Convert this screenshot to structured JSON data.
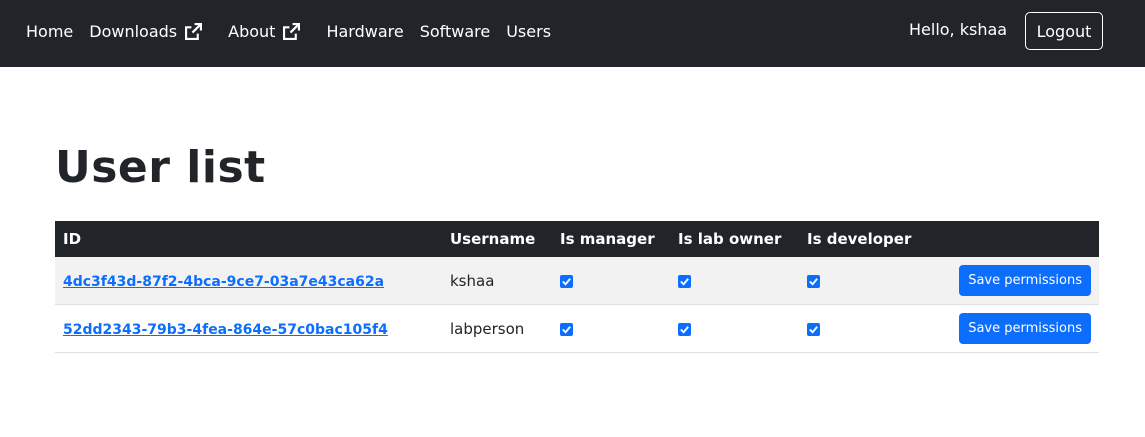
{
  "navbar": {
    "links": [
      {
        "label": "Home"
      },
      {
        "label": "Downloads",
        "icon": "external-link-icon"
      },
      {
        "label": "About",
        "icon": "external-link-icon"
      },
      {
        "label": "Hardware"
      },
      {
        "label": "Software"
      },
      {
        "label": "Users"
      }
    ],
    "greeting": "Hello, kshaa",
    "logout_label": "Logout"
  },
  "main": {
    "title": "User list",
    "table": {
      "headers": [
        "ID",
        "Username",
        "Is manager",
        "Is lab owner",
        "Is developer",
        ""
      ],
      "rows": [
        {
          "id": "4dc3f43d-87f2-4bca-9ce7-03a7e43ca62a",
          "username": "kshaa",
          "is_manager": true,
          "is_lab_owner": true,
          "is_developer": true,
          "action_label": "Save permissions"
        },
        {
          "id": "52dd2343-79b3-4fea-864e-57c0bac105f4",
          "username": "labperson",
          "is_manager": true,
          "is_lab_owner": true,
          "is_developer": true,
          "action_label": "Save permissions"
        }
      ]
    }
  },
  "colors": {
    "navbar_bg": "#212529",
    "accent": "#0d6efd",
    "row_stripe": "#f2f2f2"
  }
}
